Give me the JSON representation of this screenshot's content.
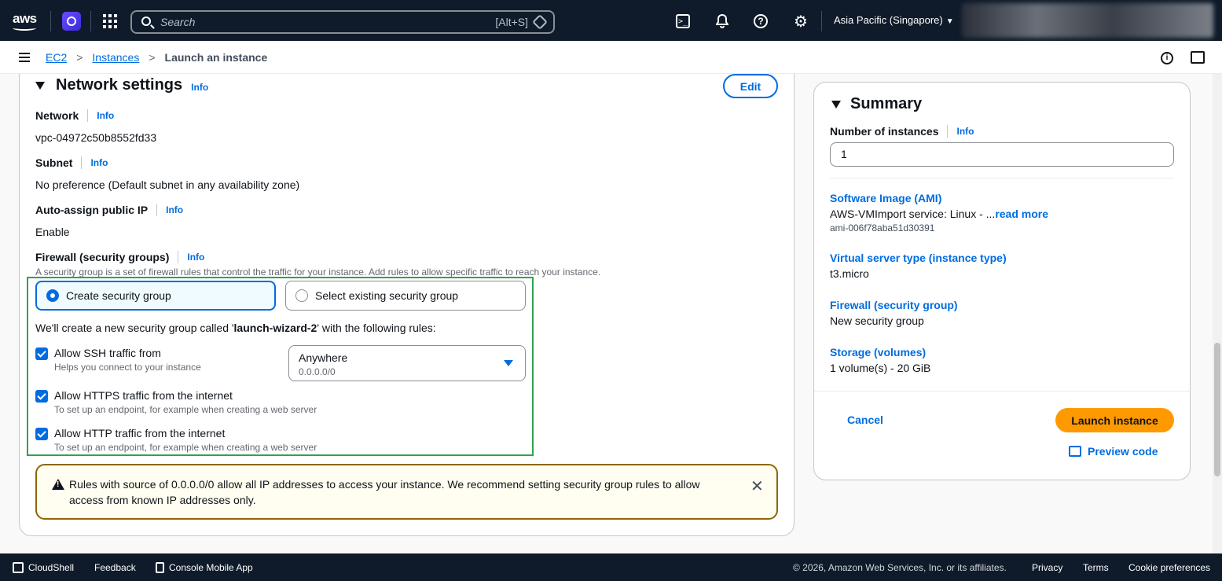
{
  "topnav": {
    "logo": "aws",
    "search_placeholder": "Search",
    "search_shortcut": "[Alt+S]",
    "region": "Asia Pacific (Singapore)",
    "icons": [
      "amazon-q-icon",
      "services-grid-icon",
      "cloudshell-icon",
      "notifications-bell-icon",
      "help-icon",
      "settings-gear-icon"
    ]
  },
  "breadcrumb": {
    "items": [
      "EC2",
      "Instances"
    ],
    "current": "Launch an instance"
  },
  "network": {
    "title": "Network settings",
    "info": "Info",
    "edit": "Edit",
    "network_label": "Network",
    "network_value": "vpc-04972c50b8552fd33",
    "subnet_label": "Subnet",
    "subnet_value": "No preference (Default subnet in any availability zone)",
    "public_ip_label": "Auto-assign public IP",
    "public_ip_value": "Enable",
    "firewall_label": "Firewall (security groups)",
    "firewall_desc": "A security group is a set of firewall rules that control the traffic for your instance. Add rules to allow specific traffic to reach your instance.",
    "option_create": "Create security group",
    "option_existing": "Select existing security group",
    "wizard_prefix": "We'll create a new security group called '",
    "wizard_name": "launch-wizard-2",
    "wizard_suffix": "' with the following rules:",
    "ssh_label": "Allow SSH traffic from",
    "ssh_desc": "Helps you connect to your instance",
    "ssh_source": "Anywhere",
    "ssh_cidr": "0.0.0.0/0",
    "https_label": "Allow HTTPS traffic from the internet",
    "https_desc": "To set up an endpoint, for example when creating a web server",
    "http_label": "Allow HTTP traffic from the internet",
    "http_desc": "To set up an endpoint, for example when creating a web server",
    "alert_text": "Rules with source of 0.0.0.0/0 allow all IP addresses to access your instance. We recommend setting security group rules to allow access from known IP addresses only."
  },
  "summary": {
    "title": "Summary",
    "num_label": "Number of instances",
    "info": "Info",
    "num_value": "1",
    "ami_key": "Software Image (AMI)",
    "ami_value": "AWS-VMImport service: Linux - ...",
    "ami_more": "read more",
    "ami_id": "ami-006f78aba51d30391",
    "type_key": "Virtual server type (instance type)",
    "type_value": "t3.micro",
    "fw_key": "Firewall (security group)",
    "fw_value": "New security group",
    "storage_key": "Storage (volumes)",
    "storage_value": "1 volume(s) - 20 GiB",
    "cancel": "Cancel",
    "launch": "Launch instance",
    "preview": "Preview code"
  },
  "footer": {
    "cloudshell": "CloudShell",
    "feedback": "Feedback",
    "mobile": "Console Mobile App",
    "copyright": "© 2026, Amazon Web Services, Inc. or its affiliates.",
    "privacy": "Privacy",
    "terms": "Terms",
    "cookies": "Cookie preferences"
  }
}
